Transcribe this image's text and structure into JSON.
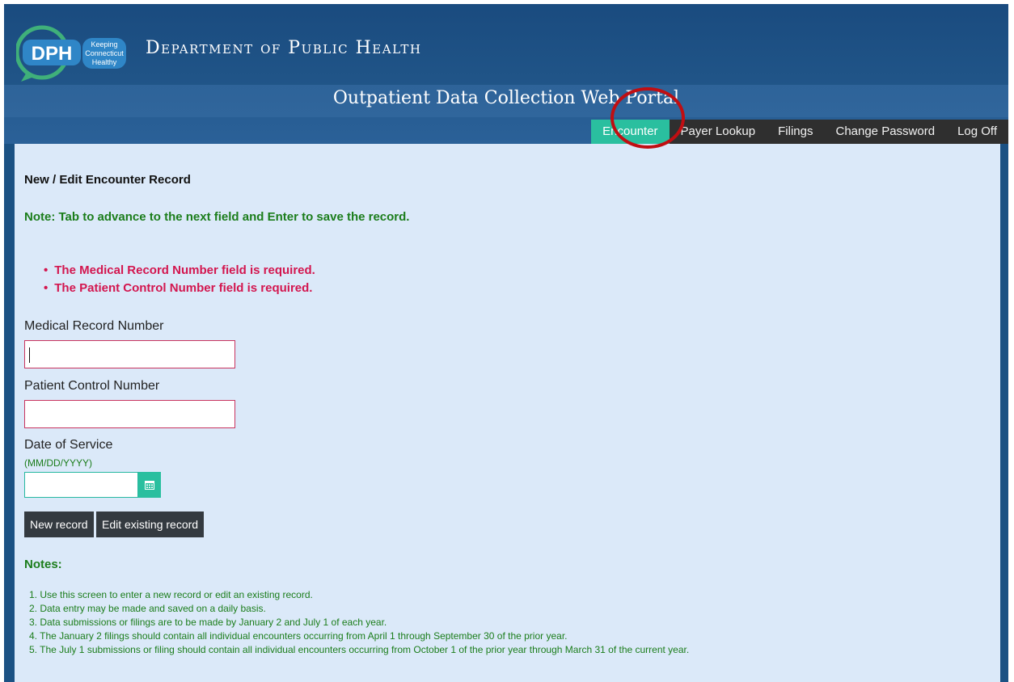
{
  "header": {
    "logo_text": "DPH",
    "logo_tagline": [
      "Keeping",
      "Connecticut",
      "Healthy"
    ],
    "department": "Department of Public Health",
    "portal_title": "Outpatient Data Collection Web Portal"
  },
  "nav": {
    "items": [
      {
        "label": "Encounter",
        "active": true
      },
      {
        "label": "Payer Lookup",
        "active": false
      },
      {
        "label": "Filings",
        "active": false
      },
      {
        "label": "Change Password",
        "active": false
      },
      {
        "label": "Log Off",
        "active": false
      }
    ]
  },
  "form": {
    "title": "New / Edit Encounter Record",
    "note": "Note: Tab to advance to the next field and Enter to save the record.",
    "errors": [
      "The Medical Record Number field is required.",
      "The Patient Control Number field is required."
    ],
    "mrn_label": "Medical Record Number",
    "mrn_value": "",
    "pcn_label": "Patient Control Number",
    "pcn_value": "",
    "dos_label": "Date of Service",
    "dos_hint": "(MM/DD/YYYY)",
    "dos_value": "",
    "new_record_label": "New record",
    "edit_record_label": "Edit existing record"
  },
  "notes": {
    "title": "Notes:",
    "items": [
      "1. Use this screen to enter a new record or edit an existing record.",
      "2. Data entry may be made and saved on a daily basis.",
      "3. Data submissions or filings are to be made by January 2 and July 1 of each year.",
      "4. The January 2 filings should contain all individual encounters occurring from April 1 through September 30 of the prior year.",
      "5. The July 1 submissions or filing should contain all individual encounters occurring from October 1 of the prior year through March 31 of the current year."
    ]
  },
  "colors": {
    "header_blue": "#1b5183",
    "nav_active": "#2abf9f",
    "error_text": "#d3164f",
    "note_green": "#1b7d1b",
    "annotation_circle": "#c00e12"
  }
}
